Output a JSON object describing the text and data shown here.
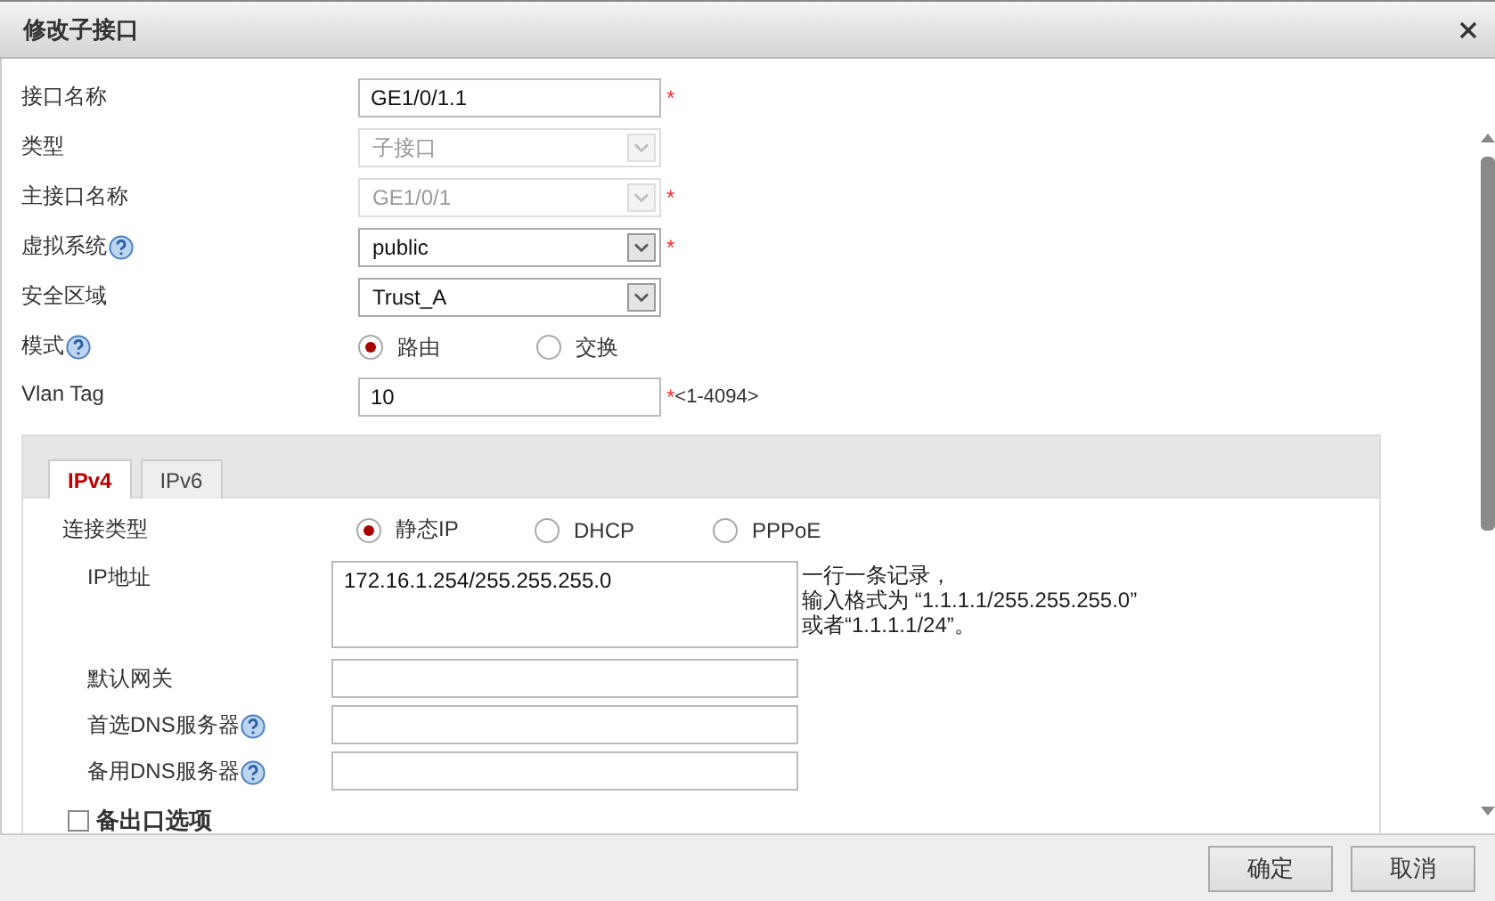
{
  "dialog": {
    "title": "修改子接口"
  },
  "fields": [
    {
      "kind": "text",
      "label": "接口名称",
      "value": "GE1/0/1.1",
      "mark": "*",
      "help": false,
      "disabled": false
    },
    {
      "kind": "select",
      "label": "类型",
      "value": "子接口",
      "help": false,
      "disabled": true
    },
    {
      "kind": "select",
      "label": "主接口名称",
      "value": "GE1/0/1",
      "mark": "*",
      "help": false,
      "disabled": true
    },
    {
      "kind": "select",
      "label": "虚拟系统",
      "value": "public",
      "mark": "*",
      "help": true,
      "disabled": false
    },
    {
      "kind": "select",
      "label": "安全区域",
      "value": "Trust_A",
      "help": false,
      "disabled": false
    },
    {
      "kind": "radio",
      "label": "模式",
      "help": true,
      "options": [
        {
          "label": "路由",
          "selected": true
        },
        {
          "label": "交换",
          "selected": false
        }
      ]
    },
    {
      "kind": "text",
      "label": "Vlan Tag",
      "value": "10",
      "mark": "*",
      "hint": "<1-4094>",
      "help": false,
      "disabled": false
    }
  ],
  "tabs": [
    {
      "label": "IPv4",
      "selected": true
    },
    {
      "label": "IPv6",
      "selected": false
    }
  ],
  "ipv4": [
    {
      "kind": "radio",
      "label": "连接类型",
      "help": false,
      "options": [
        {
          "label": "静态IP",
          "selected": true
        },
        {
          "label": "DHCP",
          "selected": false
        },
        {
          "label": "PPPoE",
          "selected": false
        }
      ]
    },
    {
      "kind": "textarea",
      "label": "IP地址",
      "value": "172.16.1.254/255.255.255.0",
      "help": false,
      "hint_lines": [
        "一行一条记录，",
        "输入格式为 “1.1.1.1/255.255.255.0”",
        "或者“1.1.1.1/24”。"
      ]
    },
    {
      "kind": "text",
      "label": "默认网关",
      "help": false
    },
    {
      "kind": "text",
      "label": "首选DNS服务器",
      "help": true
    },
    {
      "kind": "text",
      "label": "备用DNS服务器",
      "help": true
    }
  ],
  "backup_option": {
    "label": "备出口选项",
    "checked": false
  },
  "buttons": [
    "确定",
    "取消"
  ]
}
